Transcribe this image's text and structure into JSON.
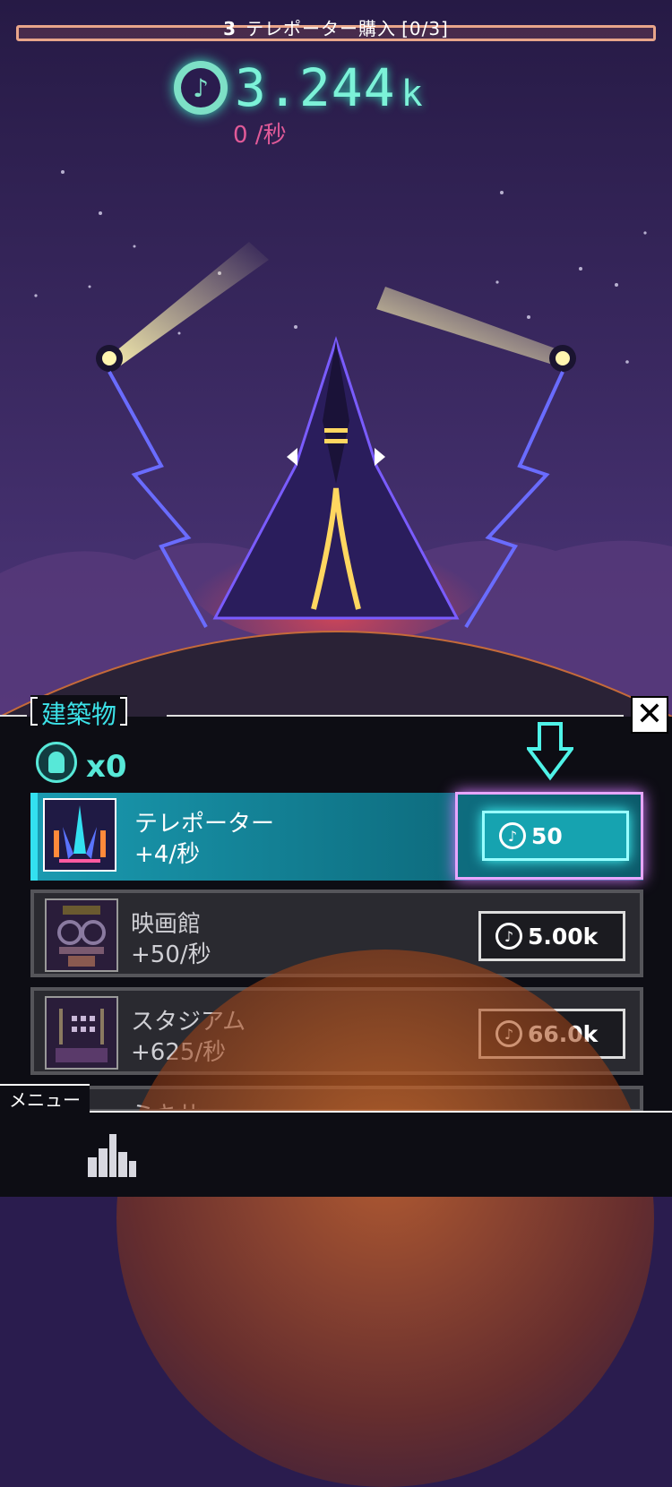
{
  "quest": {
    "number": "3",
    "text": "テレポーター購入",
    "progress": "[0/3]"
  },
  "currency": {
    "amount": "3.244",
    "unit": "k",
    "rate": "0 /秒",
    "icon": "note-coin-icon"
  },
  "panel": {
    "tab_label": "建築物",
    "close_label": "✕",
    "owned_count": "x0",
    "buildings": [
      {
        "name": "テレポーター",
        "production": "+4/秒",
        "cost": "50",
        "state": "active"
      },
      {
        "name": "映画館",
        "production": "+50/秒",
        "cost": "5.00k",
        "state": "locked"
      },
      {
        "name": "スタジアム",
        "production": "+625/秒",
        "cost": "66.0k",
        "state": "locked"
      }
    ],
    "partial_row_name": "ミキサー"
  },
  "menu": {
    "label": "メニュー"
  },
  "colors": {
    "accent": "#7cf2d8",
    "rate": "#e05a98",
    "panel": "#0d0d14",
    "highlight": "#e8a6ff"
  }
}
